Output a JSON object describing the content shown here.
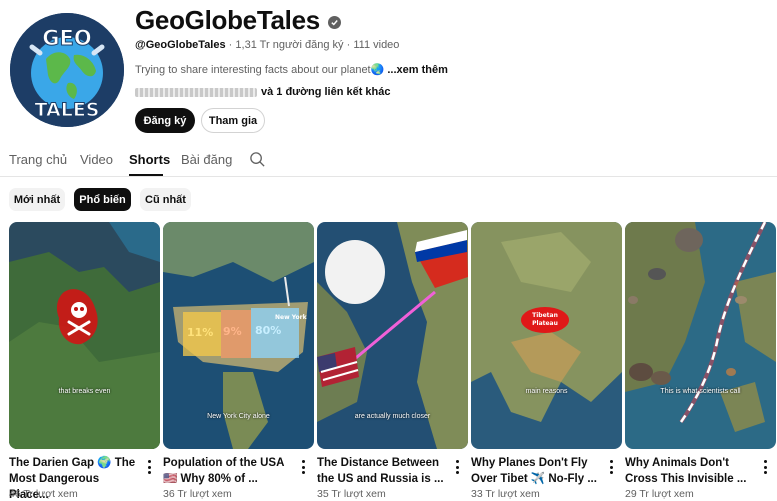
{
  "channel": {
    "avatar_text_top": "GEO",
    "avatar_text_bottom": "TALES",
    "name": "GeoGlobeTales",
    "handle": "@GeoGlobeTales",
    "subscribers": "1,31 Tr người đăng ký",
    "video_count": "111 video",
    "description": "Trying to share interesting facts about our planet🌏",
    "more_label": "...xem thêm",
    "links_label": "và 1 đường liên kết khác",
    "subscribe_label": "Đăng ký",
    "join_label": "Tham gia"
  },
  "tabs": [
    {
      "label": "Trang chủ"
    },
    {
      "label": "Video"
    },
    {
      "label": "Shorts"
    },
    {
      "label": "Bài đăng"
    }
  ],
  "active_tab": "Shorts",
  "filters": [
    {
      "label": "Mới nhất"
    },
    {
      "label": "Phổ biến"
    },
    {
      "label": "Cũ nhất"
    }
  ],
  "active_filter": "Phổ biến",
  "shorts": [
    {
      "title_line1": "The Darien Gap 🌍 The",
      "title_line2": "Most Dangerous Place...",
      "views": "46 Tr lượt xem",
      "caption": "that breaks even"
    },
    {
      "title_line1": "Population of the USA",
      "title_line2": "🇺🇸 Why 80% of ...",
      "views": "36 Tr lượt xem",
      "caption": "New York City alone",
      "overlay": [
        "11%",
        "9%",
        "80%",
        "New York"
      ]
    },
    {
      "title_line1": "The Distance Between",
      "title_line2": "the US and Russia is ...",
      "views": "35 Tr lượt xem",
      "caption": "are actually much closer"
    },
    {
      "title_line1": "Why Planes Don't Fly",
      "title_line2": "Over Tibet ✈️ No-Fly ...",
      "views": "33 Tr lượt xem",
      "caption": "main reasons",
      "overlay": [
        "Tibetan",
        "Plateau"
      ]
    },
    {
      "title_line1": "Why Animals Don't",
      "title_line2": "Cross This Invisible ...",
      "views": "29 Tr lượt xem",
      "caption": "This is what scientists call"
    }
  ],
  "colors": {
    "accent": "#0f0f0f",
    "muted": "#606060",
    "chip_bg": "#f2f2f2"
  }
}
